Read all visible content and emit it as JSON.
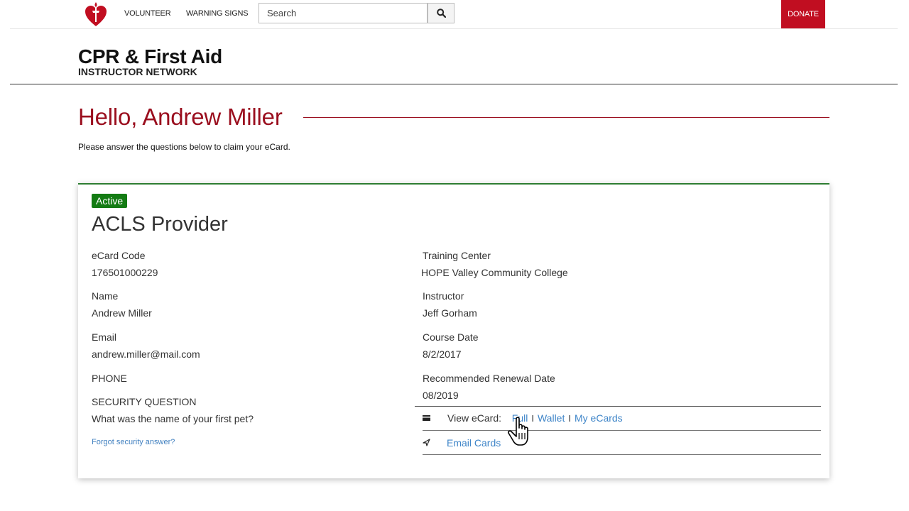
{
  "nav": {
    "volunteer": "VOLUNTEER",
    "warning_signs": "WARNING SIGNS",
    "search_placeholder": "Search",
    "donate": "DONATE"
  },
  "brand": {
    "title": "CPR & First Aid",
    "subtitle": "INSTRUCTOR NETWORK"
  },
  "greeting": "Hello, Andrew Miller",
  "intro": "Please answer the questions below to claim your eCard.",
  "card": {
    "status": "Active",
    "title": "ACLS Provider",
    "left": {
      "ecard_code_label": "eCard Code",
      "ecard_code": "176501000229",
      "name_label": "Name",
      "name": "Andrew Miller",
      "email_label": "Email",
      "email": "andrew.miller@mail.com",
      "phone_label": "PHONE",
      "security_label": "SECURITY QUESTION",
      "security_question": "What was the name of your first pet?",
      "forgot_link": "Forgot security answer?"
    },
    "right": {
      "training_center_label": "Training Center",
      "training_center": "HOPE Valley Community College",
      "instructor_label": "Instructor",
      "instructor": "Jeff Gorham",
      "course_date_label": "Course Date",
      "course_date": "8/2/2017",
      "renewal_label": "Recommended Renewal Date",
      "renewal_date": "08/2019"
    },
    "actions": {
      "view_label": "View eCard:",
      "full": "Full",
      "separator": "I",
      "wallet": "Wallet",
      "my_ecards": "My eCards",
      "email_cards": "Email Cards"
    }
  },
  "colors": {
    "brand_red": "#c10e21",
    "greeting_red": "#9a0e1e",
    "active_green": "#137b13",
    "link_blue": "#3f85c8"
  },
  "icons": [
    "heart-torch-logo",
    "search-icon",
    "card-icon",
    "send-icon",
    "hand-pointer-cursor"
  ]
}
